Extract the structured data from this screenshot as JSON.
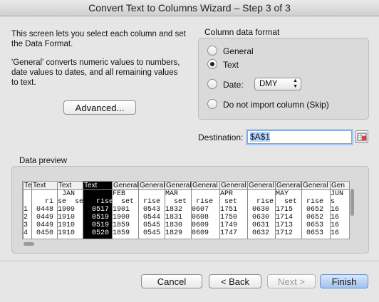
{
  "window": {
    "title": "Convert Text to Columns Wizard – Step 3 of 3"
  },
  "intro": {
    "p1": "This screen lets you select each column and set the Data Format.",
    "p2": "'General' converts numeric values to numbers, date values to dates, and all remaining values to text."
  },
  "advanced_label": "Advanced...",
  "format": {
    "title": "Column data format",
    "general": "General",
    "text": "Text",
    "date": "Date:",
    "date_value": "DMY",
    "skip": "Do not import column (Skip)",
    "selected": "text"
  },
  "destination": {
    "label": "Destination:",
    "value": "$A$1"
  },
  "preview": {
    "label": "Data preview",
    "columns": [
      {
        "header": "Te",
        "cells": [
          "",
          "",
          "1",
          "2",
          "3",
          "4"
        ]
      },
      {
        "header": "Text",
        "cells": [
          "",
          "   ri",
          " 0448",
          " 0449",
          " 0449",
          " 0450"
        ]
      },
      {
        "header": "Text",
        "cells": [
          " JAN",
          "se  set",
          "1909",
          "1910",
          "1910",
          "1910"
        ]
      },
      {
        "header": "Text",
        "cells": [
          "",
          "   rise",
          "  0517",
          "  0519",
          "  0519",
          "  0520"
        ]
      },
      {
        "header": "General",
        "cells": [
          "FEB",
          "  set",
          "1901",
          "1900",
          "1859",
          "1859"
        ]
      },
      {
        "header": "General",
        "cells": [
          "",
          " rise",
          " 0543",
          " 0544",
          " 0545",
          " 0545"
        ]
      },
      {
        "header": "General",
        "cells": [
          "MAR",
          "  set",
          "1832",
          "1831",
          "1830",
          "1829"
        ]
      },
      {
        "header": "General",
        "cells": [
          "",
          " rise",
          "0607",
          "0608",
          "0609",
          "0609"
        ]
      },
      {
        "header": "General",
        "cells": [
          "APR",
          " set",
          "1751",
          "1750",
          "1749",
          "1747"
        ]
      },
      {
        "header": "General",
        "cells": [
          "",
          "  rise",
          " 0630",
          " 0630",
          " 0631",
          " 0632"
        ]
      },
      {
        "header": "General",
        "cells": [
          "MAY",
          "  set",
          "1715",
          "1714",
          "1713",
          "1712"
        ]
      },
      {
        "header": "General",
        "cells": [
          "",
          " rise",
          " 0652",
          " 0652",
          " 0653",
          " 0653"
        ]
      },
      {
        "header": "Gen",
        "cells": [
          "JUN",
          "s",
          "16",
          "16",
          "16",
          "16"
        ]
      }
    ]
  },
  "buttons": {
    "cancel": "Cancel",
    "back": "< Back",
    "next": "Next >",
    "finish": "Finish"
  }
}
